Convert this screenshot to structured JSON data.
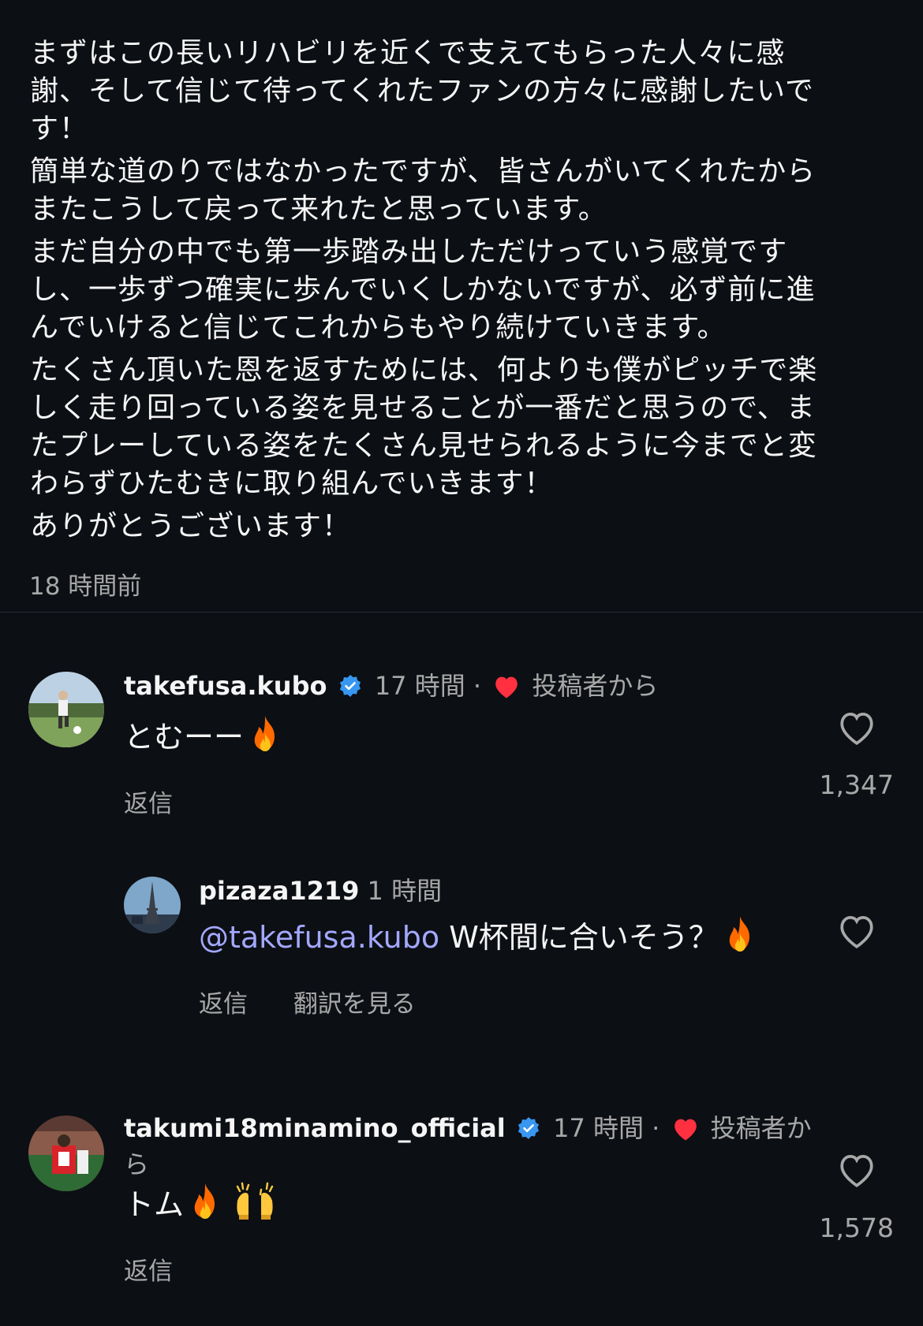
{
  "caption": {
    "paragraphs": [
      "まずはこの長いリハビリを近くで支えてもらった人々に感\n謝、そして信じて待ってくれたファンの方々に感謝したいで\nす！",
      "簡単な道のりではなかったですが、皆さんがいてくれたから\nまたこうして戻って来れたと思っています。",
      "まだ自分の中でも第一歩踏み出しただけっていう感覚です\nし、一歩ずつ確実に歩んでいくしかないですが、必ず前に進\nんでいけると信じてこれからもやり続けていきます。",
      "たくさん頂いた恩を返すためには、何よりも僕がピッチで楽\nしく走り回っている姿を見せることが一番だと思うので、ま\nたプレーしている姿をたくさん見せられるように今までと変\nわらずひたむきに取り組んでいきます！",
      "ありがとうございます！"
    ],
    "time": "18 時間前"
  },
  "comments": [
    {
      "username": "takefusa.kubo",
      "time": "17 時間",
      "sep": "·",
      "by_author": "投稿者から",
      "text": "とむーー",
      "emojis": [
        "fire-icon"
      ],
      "reply_label": "返信",
      "likes": "1,347"
    },
    {
      "username": "pizaza1219",
      "time": "1 時間",
      "mention": "@takefusa.kubo",
      "text": " W杯間に合いそう？",
      "emojis": [
        "fire-icon"
      ],
      "reply_label": "返信",
      "translate_label": "翻訳を見る"
    },
    {
      "username": "takumi18minamino_official",
      "time": "17 時間",
      "sep": "·",
      "by_author": "投稿者か",
      "by_author_wrap": "ら",
      "text": "トム",
      "emojis": [
        "fire-icon",
        "raised-hands-icon"
      ],
      "reply_label": "返信",
      "likes": "1,578"
    }
  ],
  "colors": {
    "background": "#0c0f14",
    "secondary_text": "#a8a8a8",
    "mention": "#a3a8ff",
    "verified": "#3897f0",
    "heart": "#ff3040"
  }
}
